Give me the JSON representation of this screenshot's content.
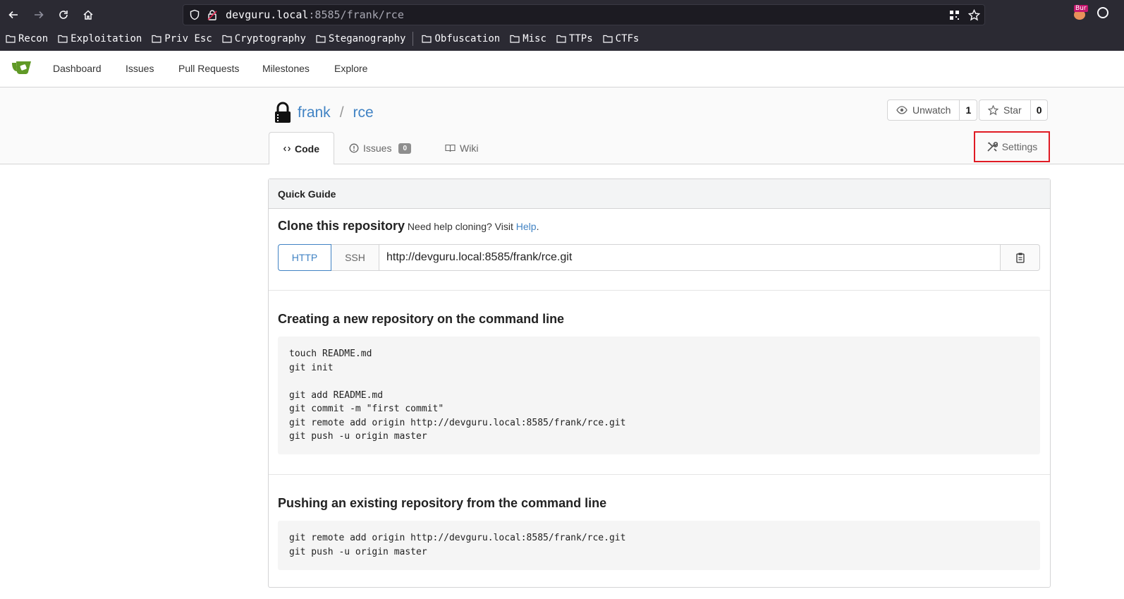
{
  "browser": {
    "url_host": "devguru.local",
    "url_path": ":8585/frank/rce",
    "extension_badge": "Bur",
    "bookmarks": [
      "Recon",
      "Exploitation",
      "Priv Esc",
      "Cryptography",
      "Steganography",
      "Obfuscation",
      "Misc",
      "TTPs",
      "CTFs"
    ]
  },
  "nav": {
    "dashboard": "Dashboard",
    "issues": "Issues",
    "pull_requests": "Pull Requests",
    "milestones": "Milestones",
    "explore": "Explore"
  },
  "repo": {
    "owner": "frank",
    "separator": "/",
    "name": "rce",
    "watch_label": "Unwatch",
    "watch_count": "1",
    "star_label": "Star",
    "star_count": "0"
  },
  "tabs": {
    "code": "Code",
    "issues": "Issues",
    "issues_count": "0",
    "wiki": "Wiki",
    "settings": "Settings"
  },
  "quick_guide": {
    "header": "Quick Guide",
    "clone_title": "Clone this repository",
    "clone_help_text": "Need help cloning? Visit",
    "clone_help_link": "Help",
    "clone_help_end": ".",
    "http_label": "HTTP",
    "ssh_label": "SSH",
    "clone_url": "http://devguru.local:8585/frank/rce.git",
    "new_repo_title": "Creating a new repository on the command line",
    "new_repo_lines": [
      "touch README.md",
      "git init",
      "",
      "git add README.md",
      "git commit -m \"first commit\"",
      "git remote add origin http://devguru.local:8585/frank/rce.git",
      "git push -u origin master"
    ],
    "push_title": "Pushing an existing repository from the command line",
    "push_lines": [
      "git remote add origin http://devguru.local:8585/frank/rce.git",
      "git push -u origin master"
    ]
  },
  "colors": {
    "link": "#4183c4",
    "highlight_box": "#e01b24",
    "browser_chrome": "#2b2a33"
  }
}
